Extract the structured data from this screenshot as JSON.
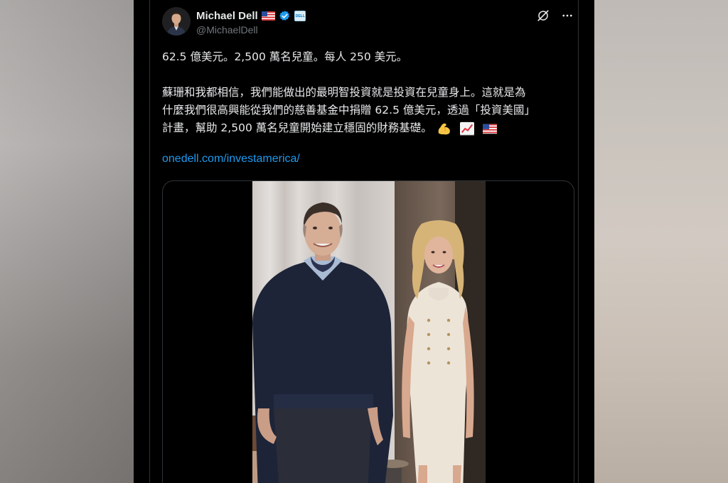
{
  "author": {
    "display_name": "Michael Dell",
    "handle": "@MichaelDell",
    "flag_icon": "us-flag-icon",
    "verified_icon": "verified-badge-icon",
    "affiliate_badge": "dell-logo-icon",
    "affiliate_badge_text": "DELL"
  },
  "actions": {
    "grok_icon": "grok-icon",
    "more_icon": "more-options-icon"
  },
  "tweet": {
    "line1": "62.5 億美元。2,500 萬名兒童。每人 250 美元。",
    "para2_line1": "蘇珊和我都相信，我們能做出的最明智投資就是投資在兒童身上。這就是為",
    "para2_line2": "什麼我們很高興能從我們的慈善基金中捐贈 62.5 億美元，透過「投資美國」",
    "para2_line3": "計畫，幫助 2,500 萬名兒童開始建立穩固的財務基礎。",
    "emojis": [
      "flexed-biceps-icon",
      "chart-increasing-icon",
      "us-flag-icon"
    ],
    "link": "onedell.com/investamerica/"
  },
  "colors": {
    "background": "#000000",
    "text": "#e7e9ea",
    "muted": "#71767b",
    "link": "#1d9bf0",
    "verified": "#1d9bf0",
    "border": "#2f3336"
  }
}
